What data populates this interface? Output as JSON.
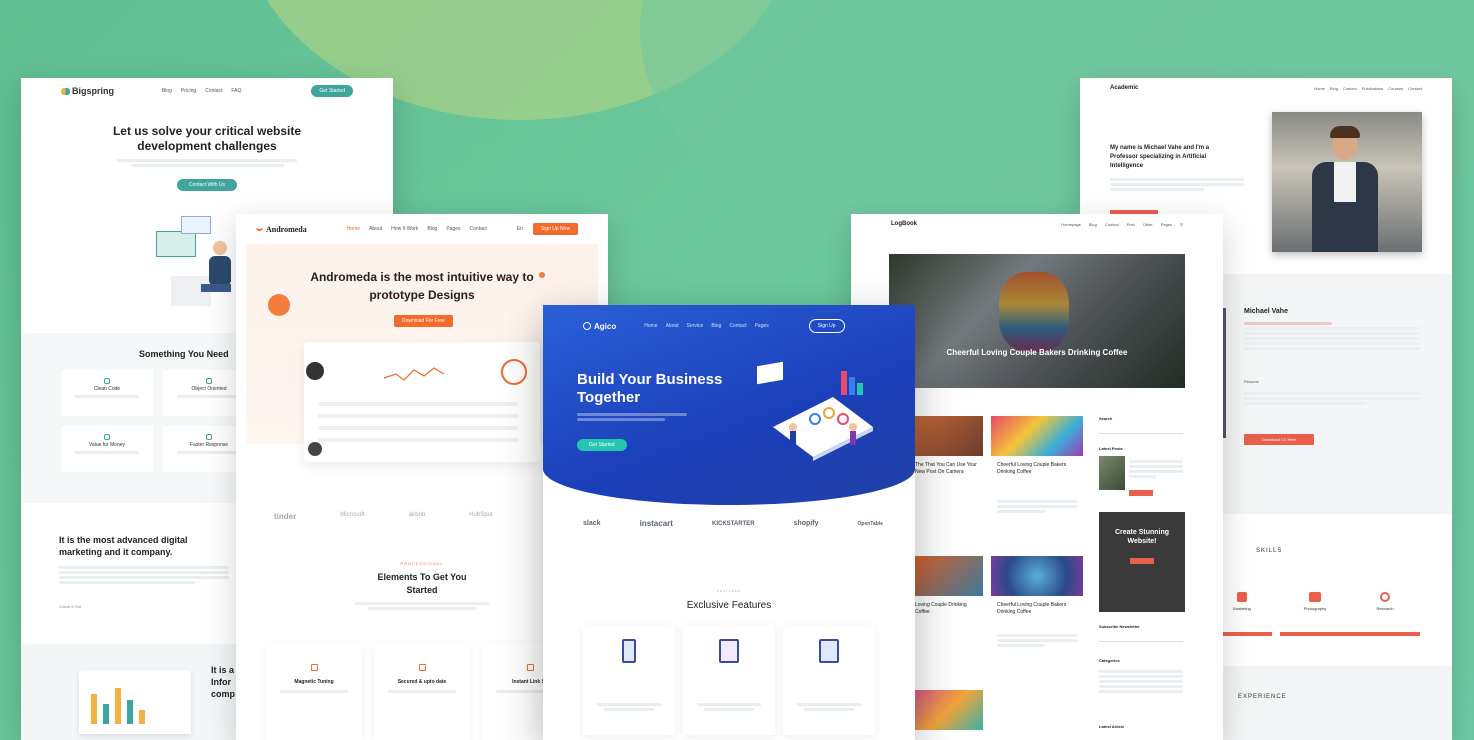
{
  "colors": {
    "bg": "#6cc89c",
    "bigspring": "#3fa49b",
    "andromeda": "#f26a2c",
    "appro": "#1f5fdb",
    "academic": "#e8604c"
  },
  "bigspring": {
    "brand": "Bigspring",
    "nav": [
      "Blog",
      "Pricing",
      "Contact",
      "FAQ"
    ],
    "cta": "Get Started",
    "hero_title": "Let us solve your critical website development challenges",
    "hero_btn": "Contact With Us",
    "section_title": "Something You Need",
    "features": [
      "Clean Code",
      "Object Oriented",
      "Value for Money",
      "Faster Response"
    ],
    "about_title": "It is the most advanced digital marketing and it company.",
    "about_link": "Check it Out",
    "bottom_title": "It is a Infor comp"
  },
  "andromeda": {
    "brand": "Andromeda",
    "nav": [
      "Home",
      "About",
      "How It Work",
      "Blog",
      "Pages",
      "Contact"
    ],
    "lang": "En",
    "cta": "Sign Up Now",
    "hero_title": "Andromeda is the most intuitive way to prototype Designs",
    "hero_btn": "Download For Free",
    "logos": [
      "tinder",
      "Microsoft",
      "airbnb",
      "HubSpot"
    ],
    "tag": "PROFESSIONAL",
    "elements_title": "Elements To Get You Started",
    "features": [
      "Magnetic Tuning",
      "Secured & upto date",
      "Instant Link Sh"
    ]
  },
  "appro": {
    "brand": "Agico",
    "nav": [
      "Home",
      "About",
      "Service",
      "Blog",
      "Contact",
      "Pages"
    ],
    "cta": "Sign Up",
    "hero_title": "Build Your Business Together",
    "hero_btn": "Get Started",
    "logos": [
      "slack",
      "instacart",
      "KICKSTARTER",
      "shopify",
      "OpenTable"
    ],
    "tag": "FEATURES",
    "section_title": "Exclusive Features"
  },
  "logbook": {
    "brand": "LogBook",
    "nav": [
      "Homepage",
      "Blog",
      "Contact",
      "Post",
      "Other",
      "Pages"
    ],
    "hero_caption": "Cheerful Loving Couple Bakers Drinking Coffee",
    "posts": [
      "Cheerful Loving Couple Bakers Drinking Coffee",
      "Cheerful Loving Couple Bakers Drinking Coffee"
    ],
    "partial_posts": [
      "The That You Can Use Your New Post On Camera",
      "Loving Couple Drinking Coffee"
    ],
    "sidebar": {
      "search": "Search",
      "about": "Latest Posts",
      "promo": "Create Stunning Website!",
      "newsletter": "Subscribe Newsletter",
      "categories": "Categories",
      "latest": "Latest Article"
    }
  },
  "academic": {
    "brand": "Academic",
    "nav": [
      "Home",
      "Blog",
      "Contact",
      "Publications",
      "Courses",
      "Contact"
    ],
    "intro": "My name is Michael Vahe and I'm a Professor specializing in Artificial Intelligence",
    "name": "Michael Vahe",
    "quote": "Resume",
    "download_btn": "Download CV Here",
    "skills_title": "SKILLS",
    "skills": [
      "Marketing",
      "Photography",
      "Research"
    ],
    "experience_title": "EXPERIENCE"
  }
}
